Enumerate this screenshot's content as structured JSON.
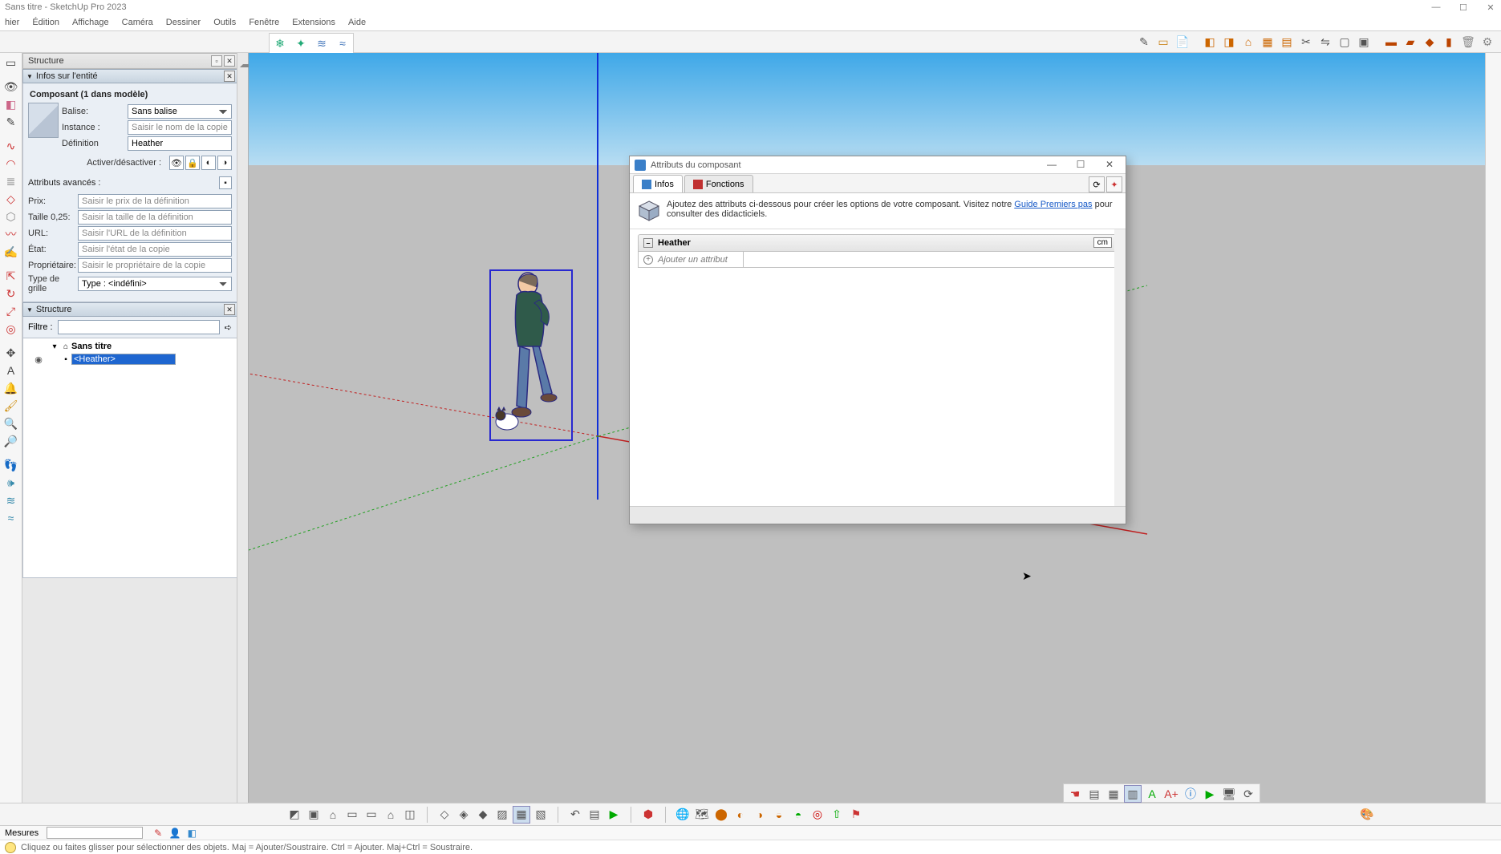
{
  "title": "Sans titre - SketchUp Pro 2023",
  "menu": [
    "hier",
    "Édition",
    "Affichage",
    "Caméra",
    "Dessiner",
    "Outils",
    "Fenêtre",
    "Extensions",
    "Aide"
  ],
  "tray": {
    "title": "Structure"
  },
  "entity_panel": {
    "title": "Infos sur l'entité",
    "component_line": "Composant (1 dans modèle)",
    "labels": {
      "balise": "Balise:",
      "instance": "Instance :",
      "definition": "Définition",
      "toggle": "Activer/désactiver :",
      "advanced": "Attributs avancés :",
      "prix": "Prix:",
      "taille": "Taille 0,25:",
      "url": "URL:",
      "etat": "État:",
      "proprietaire": "Propriétaire:",
      "grid": "Type de grille"
    },
    "balise_value": "Sans balise",
    "instance_placeholder": "Saisir le nom de la copie",
    "definition_value": "Heather",
    "prix_placeholder": "Saisir le prix de la définition",
    "taille_placeholder": "Saisir la taille de la définition",
    "url_placeholder": "Saisir l'URL de la définition",
    "etat_placeholder": "Saisir l'état de la copie",
    "proprietaire_placeholder": "Saisir le propriétaire de la copie",
    "grid_value": "Type : <indéfini>"
  },
  "structure_panel": {
    "title": "Structure",
    "filter_label": "Filtre :",
    "root": "Sans titre",
    "child": "<Heather>"
  },
  "dialog": {
    "title": "Attributs du composant",
    "tab_infos": "Infos",
    "tab_fonctions": "Fonctions",
    "info_text_pre": "Ajoutez des attributs ci-dessous pour créer les options de votre composant. Visitez notre ",
    "info_link": "Guide Premiers pas",
    "info_text_post": " pour consulter des didacticiels.",
    "component_name": "Heather",
    "unit": "cm",
    "add_attr": "Ajouter un attribut"
  },
  "status": {
    "mesures": "Mesures",
    "hint": "Cliquez ou faites glisser pour sélectionner des objets. Maj = Ajouter/Soustraire. Ctrl = Ajouter. Maj+Ctrl = Soustraire."
  }
}
